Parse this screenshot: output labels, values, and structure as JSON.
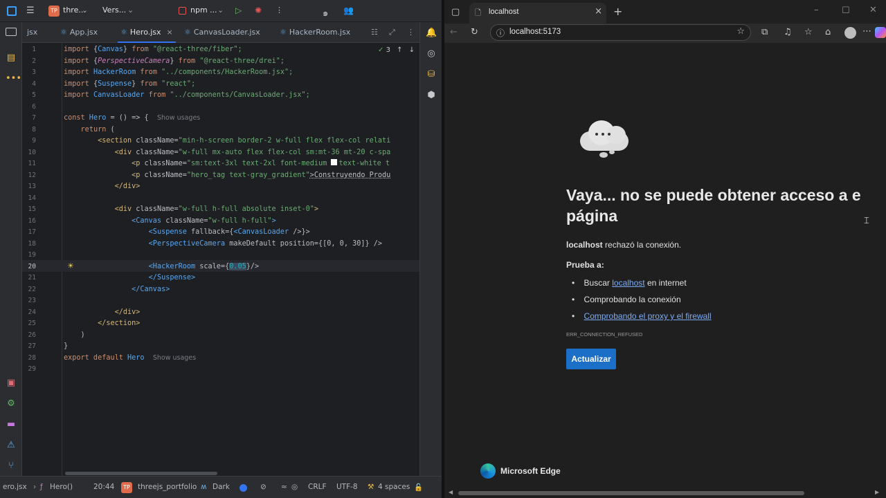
{
  "ide": {
    "titlebar": {
      "project_initials": "TP",
      "project_name": "thre...",
      "vcs_label": "Vers...",
      "run_config": "npm ..."
    },
    "tabs": [
      {
        "label": "jsx"
      },
      {
        "label": "App.jsx"
      },
      {
        "label": "Hero.jsx"
      },
      {
        "label": "CanvasLoader.jsx"
      },
      {
        "label": "HackerRoom.jsx"
      }
    ],
    "inspection_count": "3",
    "line_numbers": [
      "1",
      "2",
      "3",
      "4",
      "5",
      "6",
      "7",
      "8",
      "9",
      "10",
      "11",
      "12",
      "13",
      "14",
      "15",
      "16",
      "17",
      "18",
      "19",
      "20",
      "21",
      "22",
      "23",
      "24",
      "25",
      "26",
      "27",
      "28",
      "29"
    ],
    "code": {
      "l1": {
        "kw": "import",
        "a": " {",
        "b": "Canvas",
        "c": "} ",
        "d": "from",
        "e": " \"@react-three/fiber\";"
      },
      "l2": {
        "kw": "import",
        "a": " {",
        "b": "PerspectiveCamera",
        "c": "} ",
        "d": "from",
        "e": " \"@react-three/drei\";"
      },
      "l3": {
        "kw": "import",
        "b": " HackerRoom",
        "d": " from",
        "e": " \"../components/HackerRoom.jsx\";"
      },
      "l4": {
        "kw": "import",
        "a": " {",
        "b": "Suspense",
        "c": "} ",
        "d": "from",
        "e": " \"react\";"
      },
      "l5": {
        "kw": "import",
        "b": " CanvasLoader",
        "d": " from",
        "e": " \"../components/CanvasLoader.jsx\";"
      },
      "l7": {
        "kw": "const",
        "b": " Hero",
        "c": " = () => {",
        "hint": "Show usages"
      },
      "l8": {
        "kw": "return",
        "c": " ("
      },
      "l9": {
        "tag": "<section",
        "attr": " className=",
        "str": "\"min-h-screen border-2 w-full flex flex-col relati"
      },
      "l10": {
        "tag": "<div",
        "attr": " className=",
        "str": "\"w-full mx-auto flex flex-col sm:mt-36 mt-20 c-spa"
      },
      "l11": {
        "tag": "<p",
        "attr": " className=",
        "str": "\"sm:text-3xl text-2xl font-medium ",
        "str2": "text-white t"
      },
      "l12": {
        "tag": "<p",
        "attr": " className=",
        "str": "\"hero_tag text-gray_gradient\"",
        "text": ">Construyendo Produ"
      },
      "l13": {
        "tag": "</div>"
      },
      "l15": {
        "tag": "<div",
        "attr": " className=",
        "str": "\"w-full h-full absolute inset-0\"",
        "end": ">"
      },
      "l16": {
        "tag": "<Canvas",
        "attr": " className=",
        "str": "\"w-full h-full\"",
        "end": ">"
      },
      "l17": {
        "tag": "<Suspense",
        "attr": " fallback={",
        "comp": "<CanvasLoader",
        "end": " />}>"
      },
      "l18": {
        "tag": "<PerspectiveCamera",
        "attr": " makeDefault position={[",
        "num": "0, 0, 30",
        "end": "]} />"
      },
      "l20": {
        "tag": "<HackerRoom",
        "attr": " scale={",
        "num": "0.05",
        "end": "}/>"
      },
      "l21": {
        "tag": "</Suspense>"
      },
      "l22": {
        "tag": "</Canvas>"
      },
      "l24": {
        "tag": "</div>"
      },
      "l25": {
        "tag": "</section>"
      },
      "l26": {
        "c": ")"
      },
      "l27": {
        "c": "}"
      },
      "l28": {
        "kw": "export default",
        "b": " Hero",
        "hint": "Show usages"
      }
    },
    "statusbar": {
      "file": "ero.jsx",
      "function": "Hero()",
      "position": "20:44",
      "project_initials": "TP",
      "project": "threejs_portfolio",
      "theme": "Dark",
      "line_ending": "CRLF",
      "encoding": "UTF-8",
      "indent": "4 spaces"
    }
  },
  "browser": {
    "tab_title": "localhost",
    "url": "localhost:5173",
    "error": {
      "title": "Vaya... no se puede obtener acceso a e página",
      "host": "localhost",
      "message": " rechazó la conexión.",
      "try_label": "Prueba a:",
      "suggestions": {
        "s1_pre": "Buscar ",
        "s1_link": "localhost",
        "s1_post": " en internet",
        "s2": "Comprobando la conexión",
        "s3_link": "Comprobando el proxy y el firewall"
      },
      "code": "ERR_CONNECTION_REFUSED",
      "reload": "Actualizar"
    },
    "brand": "Microsoft Edge"
  }
}
